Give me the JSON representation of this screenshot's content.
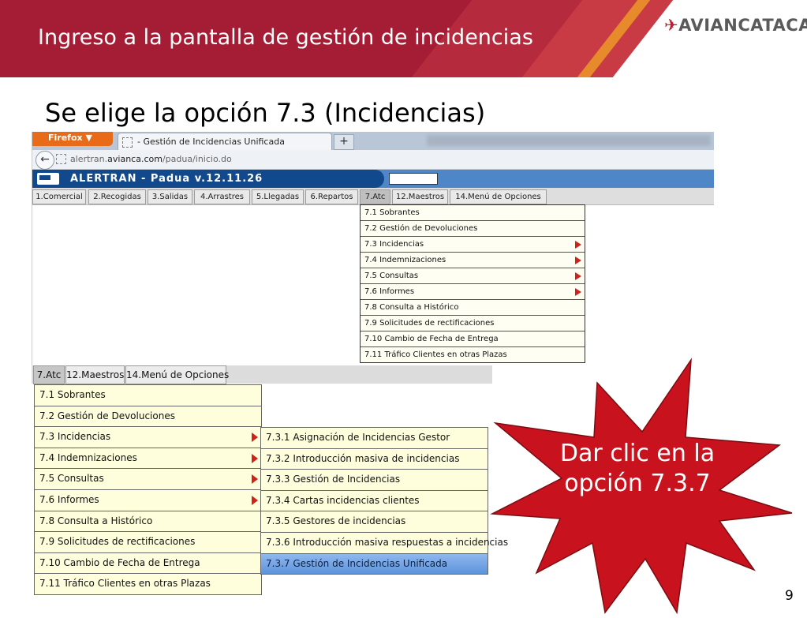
{
  "slide": {
    "title": "Ingreso a la pantalla de gestión de incidencias",
    "logo": "AVIANCATACA",
    "subtitle": "Se elige la opción 7.3 (Incidencias)",
    "page_number": "9",
    "callout": "Dar clic en la opción 7.3.7"
  },
  "browser": {
    "firefox_button": "Firefox ▼",
    "tab_title": "- Gestión de Incidencias Unificada",
    "new_tab": "+",
    "url_prefix": "alertran.",
    "url_domain": "avianca.com",
    "url_path": "/padua/inicio.do"
  },
  "app": {
    "title": "ALERTRAN - Padua  v.12.11.26",
    "menu": [
      "1.Comercial",
      "2.Recogidas",
      "3.Salidas",
      "4.Arrastres",
      "5.Llegadas",
      "6.Repartos",
      "7.Atc",
      "12.Maestros",
      "14.Menú de Opciones"
    ],
    "active_menu": "7.Atc",
    "atc_items": [
      {
        "label": "7.1 Sobrantes",
        "submenu": false
      },
      {
        "label": "7.2 Gestión de Devoluciones",
        "submenu": false
      },
      {
        "label": "7.3 Incidencias",
        "submenu": true
      },
      {
        "label": "7.4 Indemnizaciones",
        "submenu": true
      },
      {
        "label": "7.5 Consultas",
        "submenu": true
      },
      {
        "label": "7.6 Informes",
        "submenu": true
      },
      {
        "label": "7.8 Consulta a Histórico",
        "submenu": false
      },
      {
        "label": "7.9 Solicitudes de rectificaciones",
        "submenu": false
      },
      {
        "label": "7.10 Cambio de Fecha de Entrega",
        "submenu": false
      },
      {
        "label": "7.11 Tráfico Clientes en otras Plazas",
        "submenu": false
      }
    ]
  },
  "zoom": {
    "menu": [
      "7.Atc",
      "12.Maestros",
      "14.Menú de Opciones"
    ],
    "incidencias_submenu": [
      {
        "label": "7.3.1 Asignación de Incidencias Gestor",
        "selected": false
      },
      {
        "label": "7.3.2 Introducción masiva de incidencias",
        "selected": false
      },
      {
        "label": "7.3.3 Gestión de Incidencias",
        "selected": false
      },
      {
        "label": "7.3.4 Cartas incidencias clientes",
        "selected": false
      },
      {
        "label": "7.3.5 Gestores de incidencias",
        "selected": false
      },
      {
        "label": "7.3.6 Introducción masiva respuestas a incidencias",
        "selected": false
      },
      {
        "label": "7.3.7 Gestión de Incidencias Unificada",
        "selected": true
      }
    ]
  },
  "colors": {
    "header_red": "#a51d35",
    "app_blue": "#11498c",
    "menu_yellow": "#fefedc",
    "submenu_arrow": "#d1211b",
    "selected_blue": "#5d93dc",
    "burst_red": "#c8131e"
  }
}
